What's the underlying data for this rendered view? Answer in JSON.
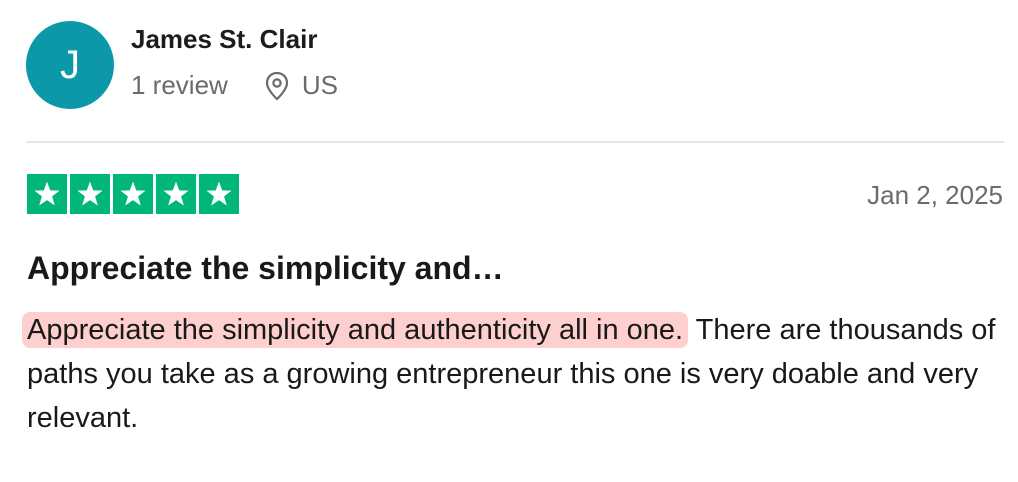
{
  "reviewer": {
    "initial": "J",
    "name": "James St. Clair",
    "review_count": "1 review",
    "country": "US",
    "avatar_color": "#0C98A9"
  },
  "review": {
    "rating": 5,
    "rating_max": 5,
    "star_color": "#00B67A",
    "date": "Jan 2, 2025",
    "title": "Appreciate the simplicity and…",
    "body_highlight": "Appreciate the simplicity and authenticity all in one.",
    "body_rest": " There are thousands of paths you take as a growing entrepreneur this one is very doable and very relevant.",
    "highlight_color": "#FDCFCF"
  },
  "icons": {
    "location": "location-pin-icon",
    "star": "star-icon"
  }
}
